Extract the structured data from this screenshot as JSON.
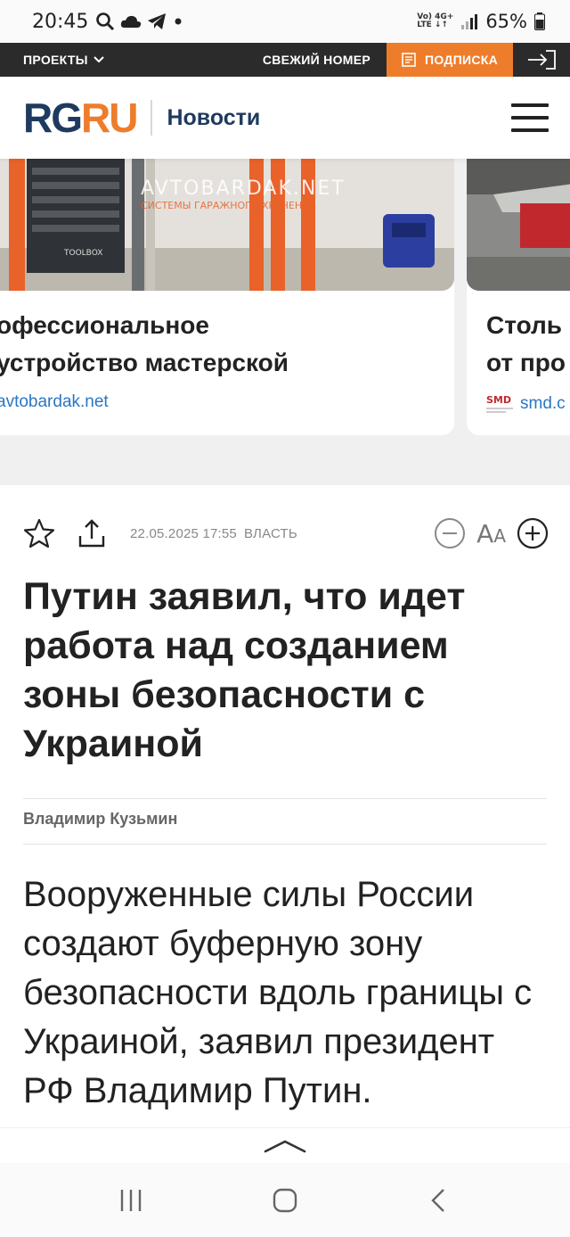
{
  "status": {
    "time": "20:45",
    "net_top": "Vo) 4G+",
    "net_bottom": "LTE ↓↑",
    "battery": "65%"
  },
  "topnav": {
    "projects": "ПРОЕКТЫ",
    "fresh_issue": "СВЕЖИЙ НОМЕР",
    "subscribe": "ПОДПИСКА"
  },
  "header": {
    "logo_rg": "RG",
    "logo_ru": "RU",
    "section": "Новости"
  },
  "ads": [
    {
      "title_line1": "офессиональное",
      "title_line2": "устройство мастерской",
      "source": "avtobardak.net",
      "watermark": "AVTOBARDAK.NET",
      "watermark_sub": "СИСТЕМЫ ГАРАЖНОГО ХРАНЕНИЯ",
      "brand": "TOOLBOX"
    },
    {
      "title_line1": "Столь",
      "title_line2": "от про",
      "source": "smd.c",
      "logo_text": "SMD"
    }
  ],
  "carousel": {
    "active_index": 0,
    "count": 5
  },
  "article": {
    "datetime": "22.05.2025 17:55",
    "rubric": "ВЛАСТЬ",
    "font_label_big": "A",
    "font_label_small": "A",
    "title": "Путин заявил, что идет работа над созданием зоны безопасности с Украиной",
    "author": "Владимир Кузьмин",
    "lead": "Вооруженные силы России создают буферную зону безопасности вдоль границы с Украиной, заявил президент РФ Владимир Путин."
  },
  "colors": {
    "accent": "#ee7d2b",
    "brand_blue": "#1f3a5f",
    "topnav_bg": "#2b2b2b",
    "link": "#2a76c4"
  }
}
